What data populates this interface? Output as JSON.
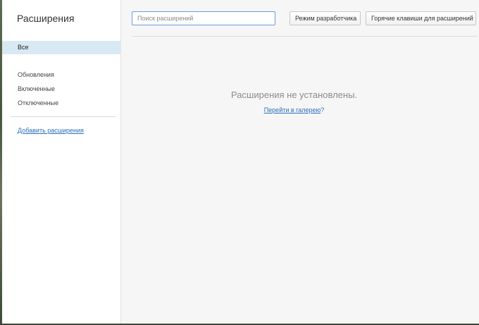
{
  "sidebar": {
    "title": "Расширения",
    "items": [
      {
        "label": "Все",
        "active": true
      },
      {
        "label": "Обновления",
        "active": false
      },
      {
        "label": "Включенные",
        "active": false
      },
      {
        "label": "Отключенные",
        "active": false
      }
    ],
    "add_link": "Добавить расширения"
  },
  "toolbar": {
    "search_placeholder": "Поиск расширений",
    "search_value": "",
    "dev_mode_label": "Режим разработчика",
    "hotkeys_label": "Горячие клавиши для расширений"
  },
  "main": {
    "empty_message": "Расширения не установлены.",
    "gallery_link": "Перейти в галерею",
    "gallery_suffix": "?"
  },
  "colors": {
    "accent_link": "#2a6ebb",
    "active_item_bg": "#d8e9f3",
    "search_border": "#6a9ed8"
  }
}
